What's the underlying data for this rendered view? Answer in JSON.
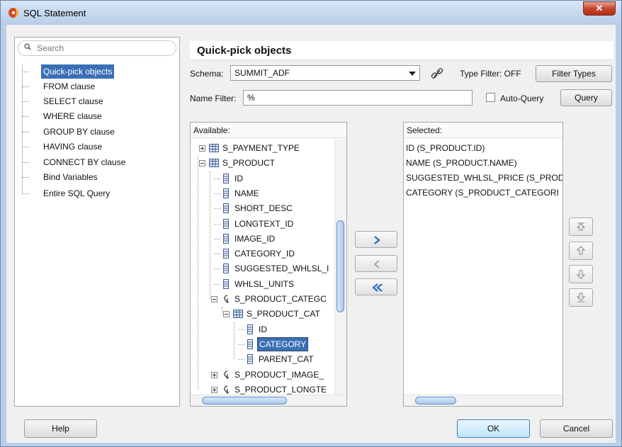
{
  "window": {
    "title": "SQL Statement"
  },
  "nav": {
    "search_placeholder": "Search",
    "items": [
      {
        "label": "Quick-pick objects",
        "selected": true
      },
      {
        "label": "FROM clause"
      },
      {
        "label": "SELECT clause"
      },
      {
        "label": "WHERE clause"
      },
      {
        "label": "GROUP BY clause"
      },
      {
        "label": "HAVING clause"
      },
      {
        "label": "CONNECT BY clause"
      },
      {
        "label": "Bind Variables"
      },
      {
        "label": "Entire SQL Query"
      }
    ]
  },
  "header": {
    "title": "Quick-pick objects"
  },
  "schema": {
    "label": "Schema:",
    "value": "SUMMIT_ADF"
  },
  "type_filter": {
    "label": "Type Filter: OFF",
    "button": "Filter Types"
  },
  "name_filter": {
    "label": "Name Filter:",
    "value": "%"
  },
  "auto_query": {
    "label": "Auto-Query",
    "checked": false
  },
  "query_button": "Query",
  "available": {
    "label": "Available:",
    "rows": [
      {
        "text": "S_PAYMENT_TYPE",
        "icon": "table-icon"
      },
      {
        "text": "S_PRODUCT",
        "icon": "table-icon"
      },
      {
        "text": "ID",
        "icon": "column-icon"
      },
      {
        "text": "NAME",
        "icon": "column-icon"
      },
      {
        "text": "SHORT_DESC",
        "icon": "column-icon"
      },
      {
        "text": "LONGTEXT_ID",
        "icon": "column-icon"
      },
      {
        "text": "IMAGE_ID",
        "icon": "column-icon"
      },
      {
        "text": "CATEGORY_ID",
        "icon": "column-icon"
      },
      {
        "text": "SUGGESTED_WHLSL_I",
        "icon": "column-icon"
      },
      {
        "text": "WHLSL_UNITS",
        "icon": "column-icon"
      },
      {
        "text": "S_PRODUCT_CATEGC",
        "icon": "foreign-key-icon"
      },
      {
        "text": "S_PRODUCT_CAT",
        "icon": "table-icon"
      },
      {
        "text": "ID",
        "icon": "column-icon"
      },
      {
        "text": "CATEGORY",
        "icon": "column-icon",
        "selected": true
      },
      {
        "text": "PARENT_CAT",
        "icon": "column-icon"
      },
      {
        "text": "S_PRODUCT_IMAGE_",
        "icon": "foreign-key-icon"
      },
      {
        "text": "S_PRODUCT_LONGTE",
        "icon": "foreign-key-icon"
      }
    ]
  },
  "selected": {
    "label": "Selected:",
    "items": [
      "ID (S_PRODUCT.ID)",
      "NAME (S_PRODUCT.NAME)",
      "SUGGESTED_WHLSL_PRICE (S_PROD",
      "CATEGORY (S_PRODUCT_CATEGORI"
    ]
  },
  "footer": {
    "help": "Help",
    "ok": "OK",
    "cancel": "Cancel"
  },
  "colors": {
    "selection": "#3a6fb5",
    "title_bar": "#b9cfe8",
    "close": "#c8442c"
  }
}
